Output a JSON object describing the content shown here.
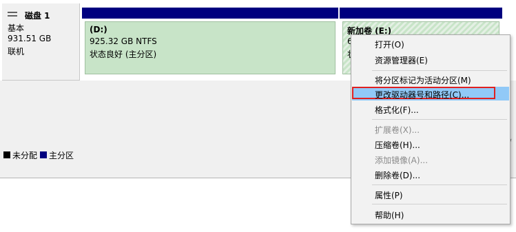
{
  "disk": {
    "name": "磁盘 1",
    "type": "基本",
    "size": "931.51 GB",
    "status": "联机"
  },
  "volumes": [
    {
      "name": "(D:)",
      "size": "925.32 GB NTFS",
      "status": "状态良好 (主分区)"
    },
    {
      "name": "新加卷  (E:)",
      "size_partial": "6",
      "status_partial": "状"
    }
  ],
  "legend": [
    {
      "label": "未分配",
      "color": "#000000"
    },
    {
      "label": "主分区",
      "color": "#00007f"
    }
  ],
  "context_menu": {
    "items": [
      {
        "label": "打开(O)",
        "enabled": true
      },
      {
        "label": "资源管理器(E)",
        "enabled": true
      },
      {
        "label": "将分区标记为活动分区(M)",
        "enabled": true
      },
      {
        "label": "更改驱动器号和路径(C)...",
        "enabled": true,
        "highlighted": true
      },
      {
        "label": "格式化(F)...",
        "enabled": true
      },
      {
        "label": "扩展卷(X)...",
        "enabled": false
      },
      {
        "label": "压缩卷(H)...",
        "enabled": true
      },
      {
        "label": "添加镜像(A)...",
        "enabled": false
      },
      {
        "label": "删除卷(D)...",
        "enabled": true
      },
      {
        "label": "属性(P)",
        "enabled": true
      },
      {
        "label": "帮助(H)",
        "enabled": true
      }
    ]
  }
}
